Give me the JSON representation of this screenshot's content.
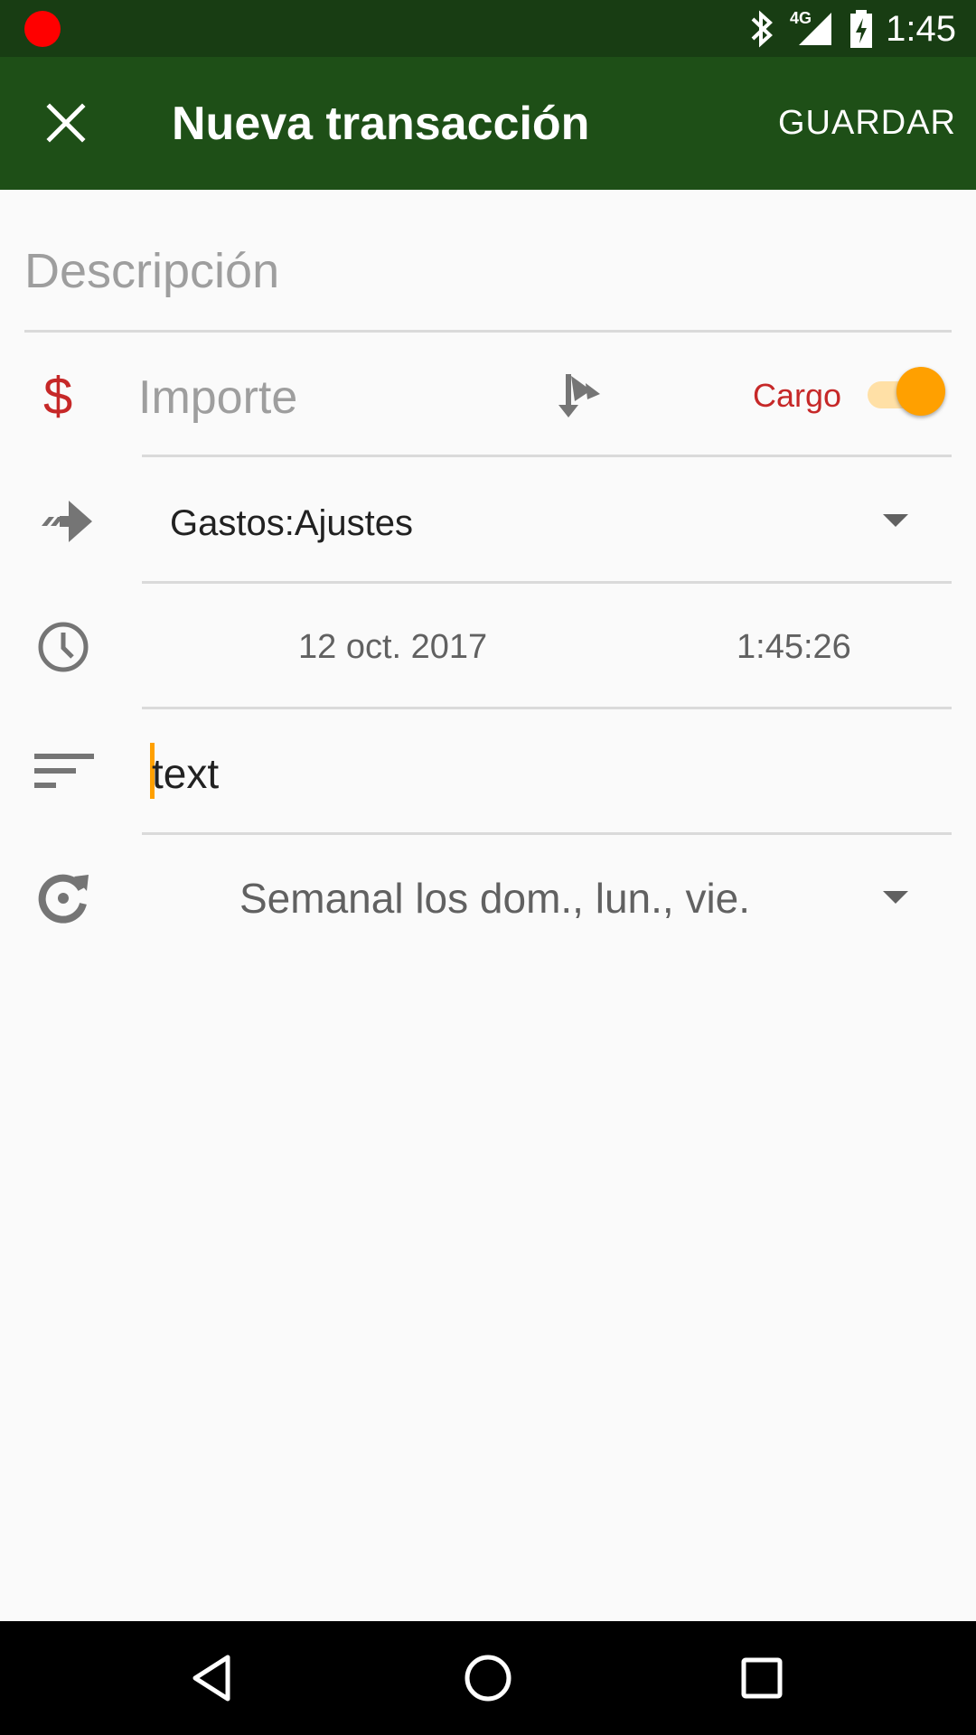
{
  "status_bar": {
    "time": "1:45",
    "network": "4G",
    "icons": [
      "recording-dot",
      "bluetooth-icon",
      "signal-icon",
      "battery-charging-icon"
    ]
  },
  "toolbar": {
    "close_icon": "close-icon",
    "title": "Nueva transacción",
    "save_label": "GUARDAR",
    "background": "#1e4f17"
  },
  "form": {
    "description": {
      "placeholder": "Descripción",
      "value": ""
    },
    "amount": {
      "currency_symbol": "$",
      "placeholder": "Importe",
      "split_icon": "split-transaction-icon",
      "type_label": "Cargo",
      "type_toggle_on": true
    },
    "transfer_account": {
      "value": "Gastos:Ajustes"
    },
    "date": "12 oct. 2017",
    "time": "1:45:26",
    "notes": {
      "value": "text"
    },
    "recurrence": {
      "value": "Semanal los dom., lun., vie."
    }
  },
  "nav_bar": {
    "buttons": [
      "back-icon",
      "home-icon",
      "recents-icon"
    ]
  },
  "colors": {
    "accent": "#ffa000",
    "debit_red": "#c62828",
    "status_bar": "#183d13"
  }
}
